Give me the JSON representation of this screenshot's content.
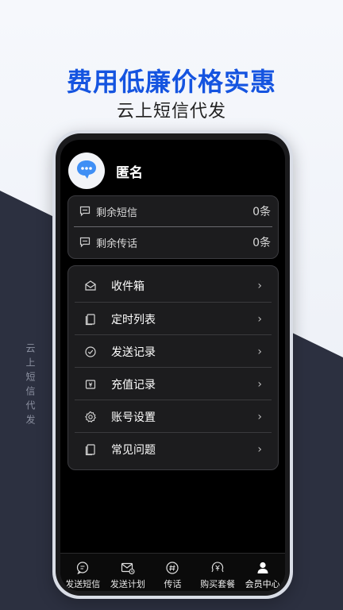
{
  "promo": {
    "headline": "费用低廉价格实惠",
    "subline": "云上短信代发",
    "side_text": "云上短信代发"
  },
  "colors": {
    "headline": "#1554e0",
    "dark_band": "#2c3040",
    "screen_bg": "#000000",
    "card_bg": "#1c1c1e"
  },
  "profile": {
    "username": "匿名",
    "avatar_icon": "chat-bubble-icon"
  },
  "quota": [
    {
      "label": "剩余短信",
      "value": "0条",
      "icon": "message-square-icon"
    },
    {
      "label": "剩余传话",
      "value": "0条",
      "icon": "message-square-icon"
    }
  ],
  "menu": [
    {
      "label": "收件箱",
      "icon": "envelope-open-icon"
    },
    {
      "label": "定时列表",
      "icon": "document-list-icon"
    },
    {
      "label": "发送记录",
      "icon": "check-circle-icon"
    },
    {
      "label": "充值记录",
      "icon": "yuan-card-icon"
    },
    {
      "label": "账号设置",
      "icon": "gear-icon"
    },
    {
      "label": "常见问题",
      "icon": "document-question-icon"
    }
  ],
  "chevron": "›",
  "tabs": [
    {
      "label": "发送短信",
      "icon": "message-icon"
    },
    {
      "label": "发送计划",
      "icon": "mail-clock-icon"
    },
    {
      "label": "传话",
      "icon": "hash-circle-icon"
    },
    {
      "label": "购买套餐",
      "icon": "yuan-circle-icon"
    },
    {
      "label": "会员中心",
      "icon": "user-icon",
      "active": true
    }
  ]
}
